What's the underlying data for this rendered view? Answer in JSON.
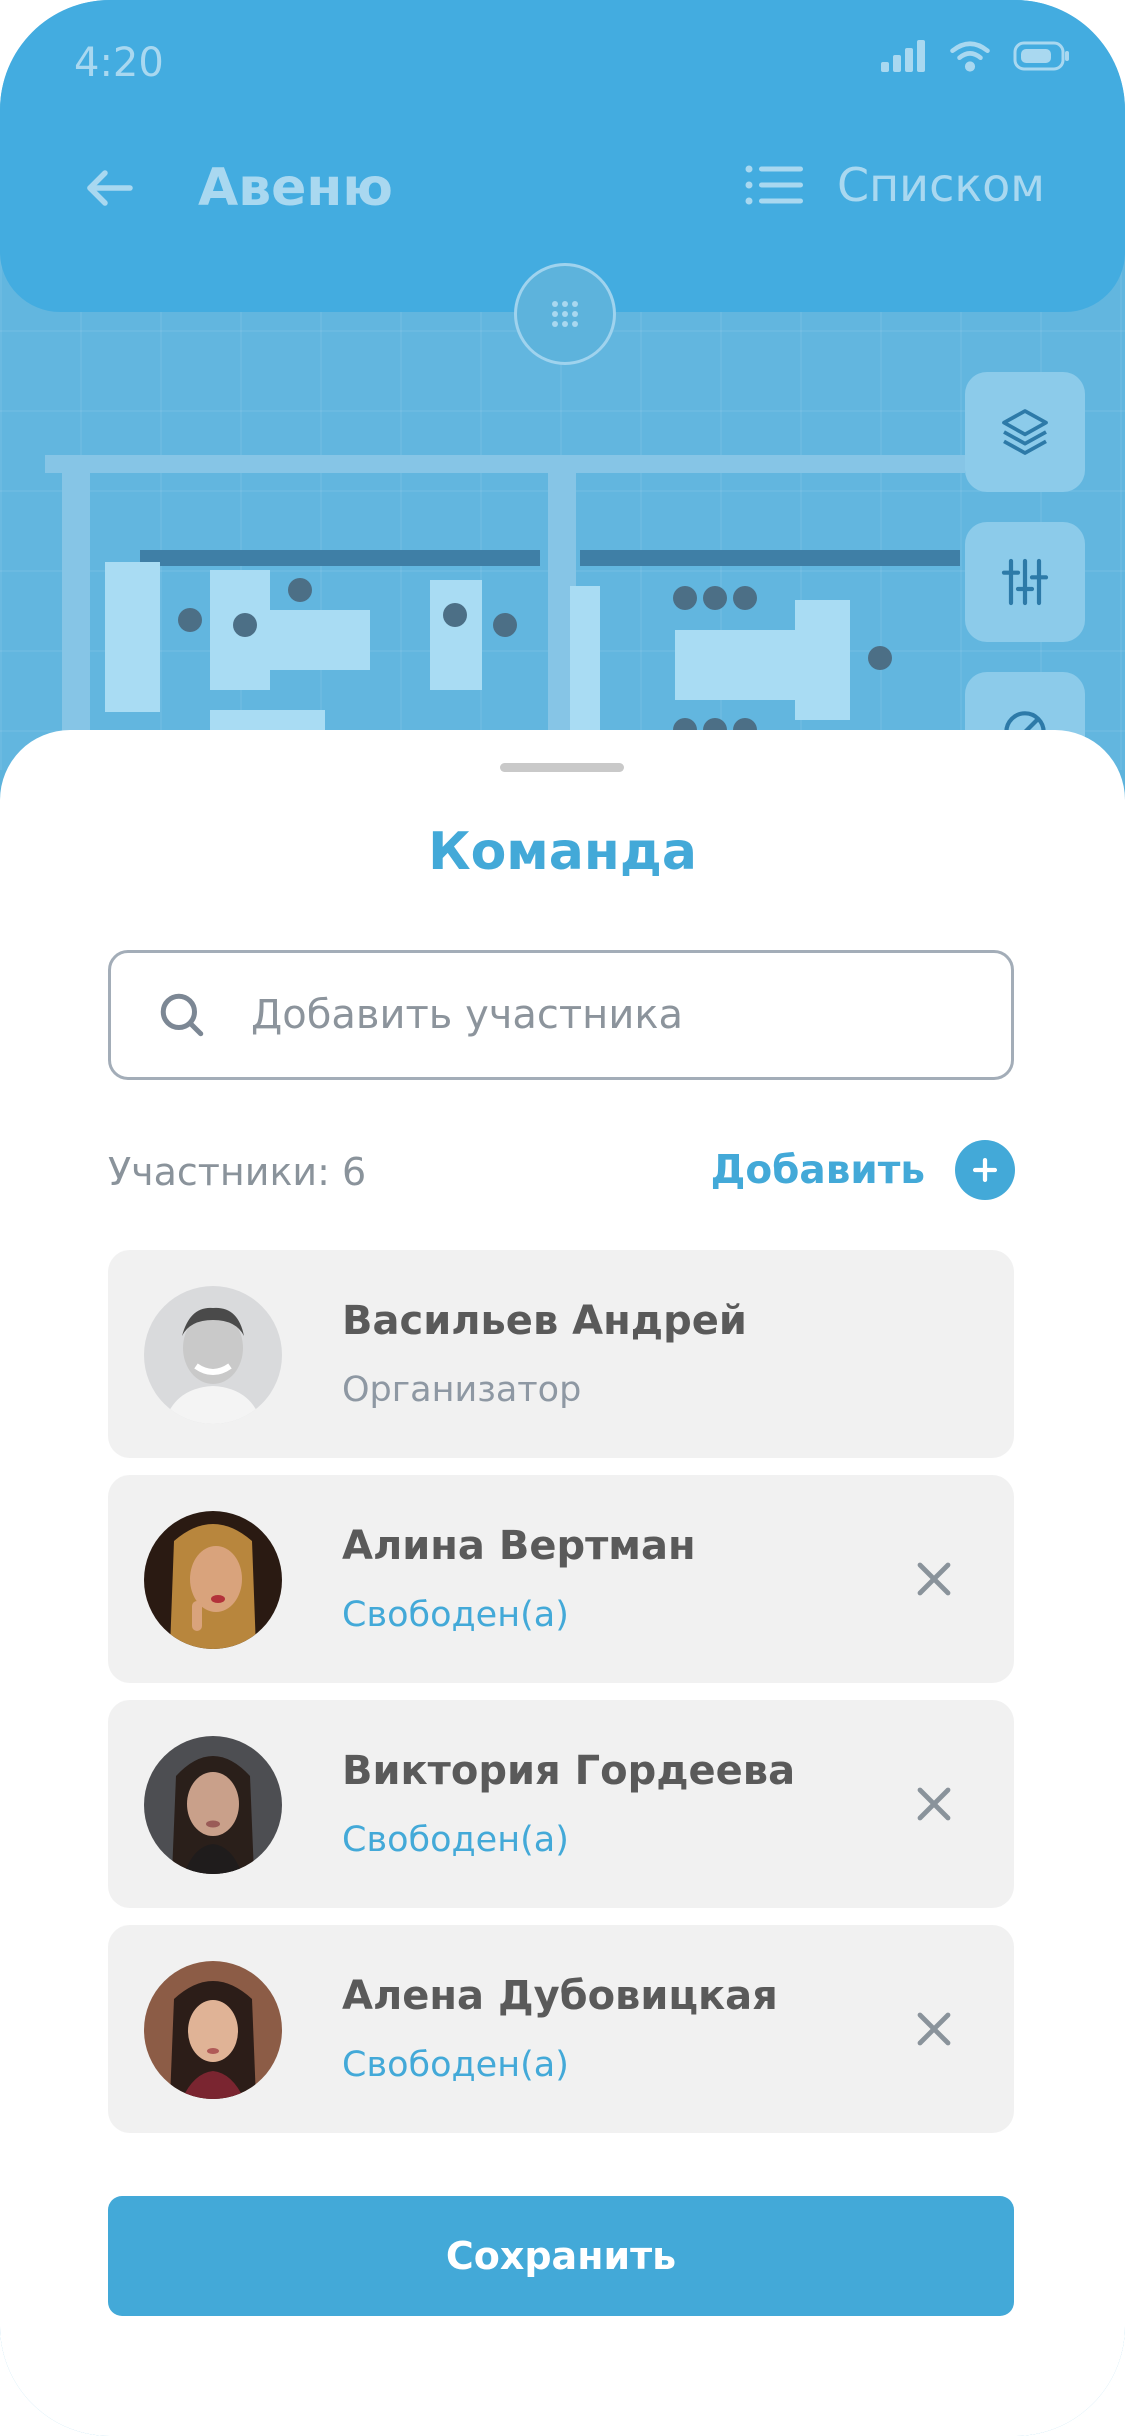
{
  "status_bar": {
    "time": "4:20"
  },
  "header": {
    "title": "Авеню",
    "view_toggle_label": "Списком"
  },
  "sheet": {
    "title": "Команда",
    "search": {
      "placeholder": "Добавить участника",
      "value": ""
    },
    "participants_count_label": "Участники: 6",
    "add_label": "Добавить",
    "members": [
      {
        "name": "Васильев Андрей",
        "status": "Организатор",
        "status_color": "#8e98a3",
        "removable": false
      },
      {
        "name": "Алина Вертман",
        "status": "Свободен(а)",
        "status_color": "#43a9d8",
        "removable": true
      },
      {
        "name": "Виктория Гордеева",
        "status": "Свободен(а)",
        "status_color": "#43a9d8",
        "removable": true
      },
      {
        "name": "Алена Дубовицкая",
        "status": "Свободен(а)",
        "status_color": "#43a9d8",
        "removable": true
      }
    ],
    "save_label": "Сохранить"
  },
  "colors": {
    "accent": "#43a9d8",
    "header": "#43ace0",
    "card": "#f1f1f1"
  }
}
